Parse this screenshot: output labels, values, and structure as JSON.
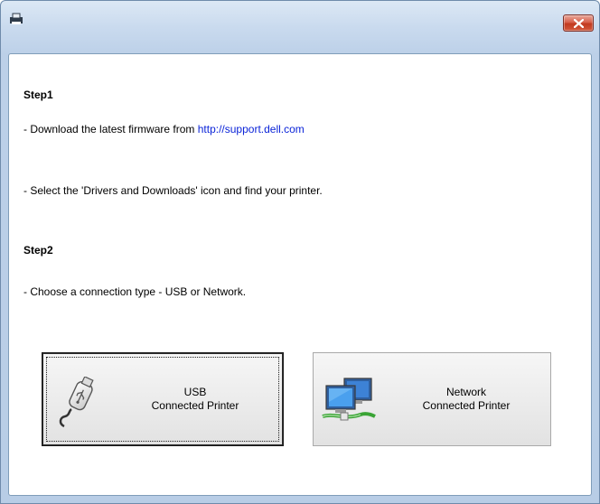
{
  "window": {
    "title": ""
  },
  "step1": {
    "heading": "Step1",
    "line1_prefix": "- Download the latest firmware from ",
    "line1_link": "http://support.dell.com",
    "line2": "- Select the 'Drivers and Downloads' icon and find your printer."
  },
  "step2": {
    "heading": "Step2",
    "line1": "- Choose a connection type - USB or Network."
  },
  "buttons": {
    "usb": {
      "line1": "USB",
      "line2": "Connected Printer",
      "icon": "usb-drive-icon"
    },
    "network": {
      "line1": "Network",
      "line2": "Connected Printer",
      "icon": "network-computers-icon"
    }
  },
  "colors": {
    "link": "#0b24d8",
    "close": "#c2391f"
  }
}
